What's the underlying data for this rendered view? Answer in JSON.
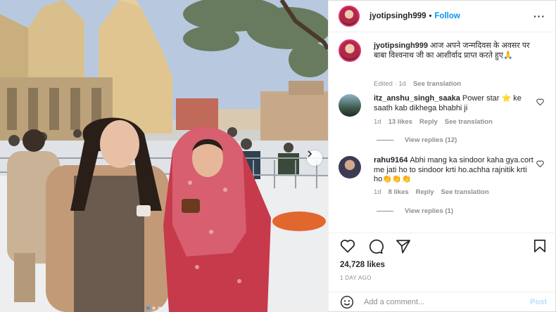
{
  "post": {
    "image_alt": "Two women posing in front of a temple",
    "carousel": {
      "count": 3,
      "active_index": 0
    }
  },
  "header": {
    "username": "jyotipsingh999",
    "separator": "•",
    "follow_label": "Follow",
    "more_label": "···"
  },
  "caption": {
    "username": "jyotipsingh999",
    "text": "आज अपने जन्मदिवस के अवसर पर बाबा विश्वनाथ जी का आशीर्वाद प्राप्त करते हुए🙏",
    "edited": "Edited · 1d",
    "see_translation": "See translation"
  },
  "comments": [
    {
      "username": "itz_anshu_singh_saaka",
      "text": "Power star ⭐ ke saath kab dikhega bhabhi ji",
      "time": "1d",
      "likes": "13 likes",
      "reply": "Reply",
      "see_translation": "See translation",
      "view_replies": "View replies (12)"
    },
    {
      "username": "rahu9164",
      "text": "Abhi mang ka sindoor kaha gya.cort me jati ho to sindoor krti ho.achha rajnitik krti ho👏👏👏",
      "time": "1d",
      "likes": "8 likes",
      "reply": "Reply",
      "see_translation": "See translation",
      "view_replies": "View replies (1)"
    }
  ],
  "stats": {
    "likes": "24,728 likes",
    "date": "1 DAY AGO"
  },
  "comment_box": {
    "placeholder": "Add a comment...",
    "post_label": "Post"
  },
  "icons": {
    "like": "heart-icon",
    "comment": "comment-icon",
    "share": "paper-plane-icon",
    "save": "bookmark-icon",
    "emoji": "smiley-icon",
    "next": "chevron-right-icon"
  },
  "colors": {
    "accent": "#0095f6",
    "post_disabled": "#b2dffc",
    "muted": "#8e8e8e",
    "text": "#262626"
  }
}
